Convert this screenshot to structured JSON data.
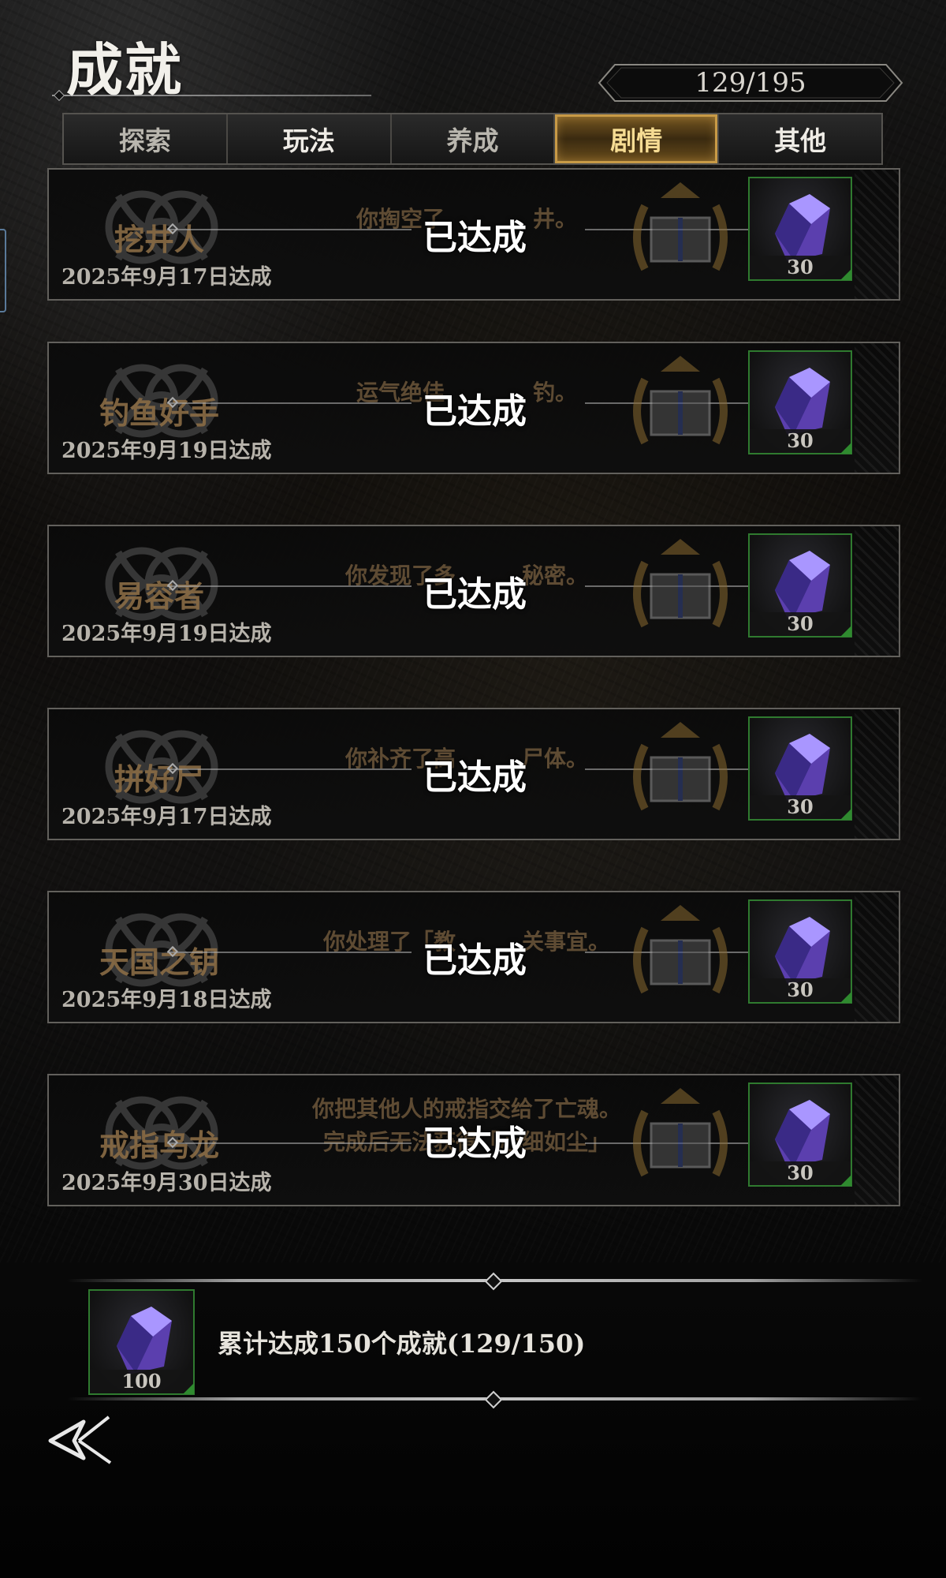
{
  "header": {
    "title": "成就",
    "progress": "129/195"
  },
  "tabs": [
    {
      "label": "探索",
      "active": false
    },
    {
      "label": "玩法",
      "active": false
    },
    {
      "label": "养成",
      "active": false
    },
    {
      "label": "剧情",
      "active": true
    },
    {
      "label": "其他",
      "active": false
    }
  ],
  "achievements": [
    {
      "name": "挖井人",
      "desc": "你掏空了　　　　井。",
      "status": "已达成",
      "date": "2025年9月17日达成",
      "reward_count": "30"
    },
    {
      "name": "钓鱼好手",
      "desc": "运气绝佳　　　　钓。",
      "status": "已达成",
      "date": "2025年9月19日达成",
      "reward_count": "30"
    },
    {
      "name": "易容者",
      "desc": "你发现了多　　　秘密。",
      "status": "已达成",
      "date": "2025年9月19日达成",
      "reward_count": "30"
    },
    {
      "name": "拼好尸",
      "desc": "你补齐了高　　　尸体。",
      "status": "已达成",
      "date": "2025年9月17日达成",
      "reward_count": "30"
    },
    {
      "name": "天国之钥",
      "desc": "你处理了「教　　　关事宜。",
      "status": "已达成",
      "date": "2025年9月18日达成",
      "reward_count": "30"
    },
    {
      "name": "戒指乌龙",
      "desc": "你把其他人的戒指交给了亡魂。",
      "desc2": "完成后无法获得「心细如尘」",
      "status": "已达成",
      "date": "2025年9月30日达成",
      "reward_count": "30"
    }
  ],
  "summary": {
    "text": "累计达成150个成就(129/150)",
    "reward_count": "100"
  },
  "colors": {
    "accent_gold": "#c89a46",
    "reward_border": "#2f7a2f",
    "crystal": "#7a5cd6"
  }
}
